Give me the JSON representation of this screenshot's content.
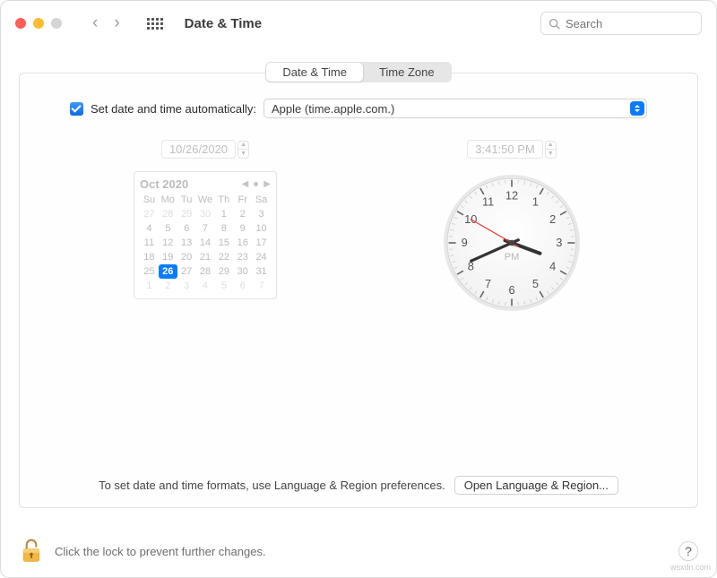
{
  "header": {
    "title": "Date & Time",
    "search_placeholder": "Search"
  },
  "tabs": {
    "date_time": "Date & Time",
    "time_zone": "Time Zone"
  },
  "auto": {
    "checked": true,
    "label": "Set date and time automatically:",
    "server": "Apple (time.apple.com.)"
  },
  "date_field": "10/26/2020",
  "time_field": "3:41:50 PM",
  "calendar": {
    "month_label": "Oct 2020",
    "dow": [
      "Su",
      "Mo",
      "Tu",
      "We",
      "Th",
      "Fr",
      "Sa"
    ],
    "weeks": [
      [
        {
          "d": "27",
          "o": true
        },
        {
          "d": "28",
          "o": true
        },
        {
          "d": "29",
          "o": true
        },
        {
          "d": "30",
          "o": true
        },
        {
          "d": "1"
        },
        {
          "d": "2"
        },
        {
          "d": "3"
        }
      ],
      [
        {
          "d": "4"
        },
        {
          "d": "5"
        },
        {
          "d": "6"
        },
        {
          "d": "7"
        },
        {
          "d": "8"
        },
        {
          "d": "9"
        },
        {
          "d": "10"
        }
      ],
      [
        {
          "d": "11"
        },
        {
          "d": "12"
        },
        {
          "d": "13"
        },
        {
          "d": "14"
        },
        {
          "d": "15"
        },
        {
          "d": "16"
        },
        {
          "d": "17"
        }
      ],
      [
        {
          "d": "18"
        },
        {
          "d": "19"
        },
        {
          "d": "20"
        },
        {
          "d": "21"
        },
        {
          "d": "22"
        },
        {
          "d": "23"
        },
        {
          "d": "24"
        }
      ],
      [
        {
          "d": "25"
        },
        {
          "d": "26",
          "sel": true
        },
        {
          "d": "27"
        },
        {
          "d": "28"
        },
        {
          "d": "29"
        },
        {
          "d": "30"
        },
        {
          "d": "31"
        }
      ],
      [
        {
          "d": "1",
          "o": true
        },
        {
          "d": "2",
          "o": true
        },
        {
          "d": "3",
          "o": true
        },
        {
          "d": "4",
          "o": true
        },
        {
          "d": "5",
          "o": true
        },
        {
          "d": "6",
          "o": true
        },
        {
          "d": "7",
          "o": true
        }
      ]
    ]
  },
  "clock": {
    "period": "PM",
    "hour": 3,
    "minute": 41,
    "second": 50
  },
  "footer": {
    "hint": "To set date and time formats, use Language & Region preferences.",
    "button": "Open Language & Region..."
  },
  "lock": {
    "text": "Click the lock to prevent further changes."
  },
  "help_label": "?",
  "watermark": "wsxdn.com"
}
